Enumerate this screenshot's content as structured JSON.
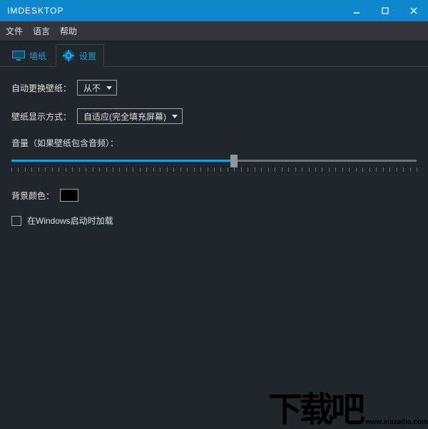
{
  "title": "IMDESKTOP",
  "menu": {
    "file": "文件",
    "language": "语言",
    "help": "帮助"
  },
  "tabs": {
    "wallpaper": "墙纸",
    "settings": "设置"
  },
  "settings": {
    "auto_change_label": "自动更换壁纸：",
    "auto_change_value": "从不",
    "display_mode_label": "壁纸显示方式：",
    "display_mode_value": "自适应(完全填充屏幕)",
    "volume_label": "音量（如果壁纸包含音频）：",
    "volume_percent": 55,
    "bg_color_label": "背景颜色：",
    "bg_color_value": "#000000",
    "startup_label": "在Windows启动时加载"
  },
  "watermark": {
    "text": "下载吧",
    "url": "www.xiazaiba.com"
  }
}
